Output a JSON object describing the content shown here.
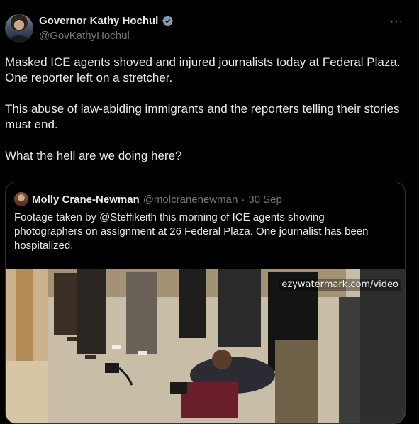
{
  "author": {
    "display_name": "Governor Kathy Hochul",
    "handle": "@GovKathyHochul",
    "verified_icon": "verified-badge-icon",
    "more_icon": "more-icon",
    "more_glyph": "···"
  },
  "tweet": {
    "paragraphs": [
      "Masked ICE agents shoved and injured journalists today at Federal Plaza. One reporter left on a stretcher.",
      "This abuse of law-abiding immigrants and the reporters telling their stories must end.",
      "What the hell are we doing here?"
    ]
  },
  "quote": {
    "display_name": "Molly Crane-Newman",
    "handle": "@molcranenewman",
    "separator": "·",
    "date": "30 Sep",
    "text": "Footage taken by @Steffikeith this morning of ICE agents shoving photographers on assignment at 26 Federal Plaza. One journalist has been hospitalized.",
    "video_watermark": "ezywatermark.com/video"
  },
  "colors": {
    "background": "#000000",
    "text": "#e7e9ea",
    "secondary": "#71767b",
    "border": "#2f3336",
    "verified": "#829aab"
  }
}
